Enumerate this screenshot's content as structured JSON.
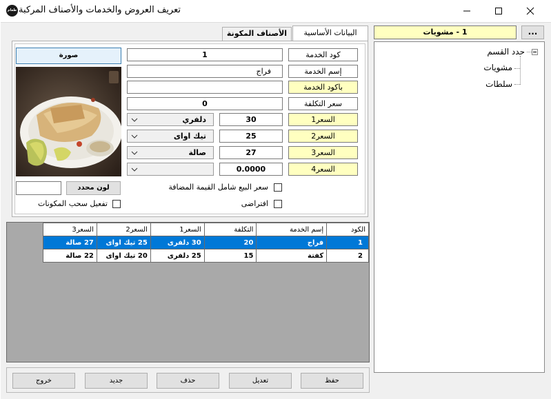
{
  "window": {
    "title": "تعريف العروض والخدمات والأصناف المركبة",
    "app_icon_text": "طعام"
  },
  "tabs": [
    {
      "label": "البيانات الأساسية"
    },
    {
      "label": "الأصناف المكونة"
    }
  ],
  "form": {
    "image_button": "صورة",
    "service_code_label": "كود الخدمة",
    "service_code_value": "1",
    "service_name_label": "إسم الخدمة",
    "service_name_value": "فراج",
    "barcode_label": "باكود الخدمة",
    "barcode_value": "",
    "cost_label": "سعر التكلفة",
    "cost_value": "0",
    "price1_label": "السعر1",
    "price1_value": "30",
    "price1_type": "دلفري",
    "price2_label": "السعر2",
    "price2_value": "25",
    "price2_type": "تيك اواى",
    "price3_label": "السعر3",
    "price3_value": "27",
    "price3_type": "صالة",
    "price4_label": "السعر4",
    "price4_value": "0.0000",
    "price4_type": "",
    "color_button": "لون محدد",
    "vat_checkbox_label": "سعر البيع شامل القيمة المضافة",
    "default_checkbox_label": "افتراضى",
    "components_checkbox_label": "تفعيل سحب المكونات"
  },
  "grid": {
    "headers": [
      "الكود",
      "إسم الخدمة",
      "التكلفة",
      "السعر1",
      "السعر2",
      "السعر3"
    ],
    "rows": [
      [
        "1",
        "فراج",
        "20",
        "30 دلفرى",
        "25 تيك اواى",
        "27 صالة"
      ],
      [
        "2",
        "كفتة",
        "15",
        "25 دلفرى",
        "20 تيك اواى",
        "22 صالة"
      ]
    ]
  },
  "buttons": {
    "save": "حفظ",
    "edit": "تعديل",
    "delete": "حذف",
    "new": "جديد",
    "exit": "خروج"
  },
  "category": {
    "selected": "1 - مشويات",
    "browse": "..."
  },
  "tree": {
    "root": "حدد القسم",
    "children": [
      "مشويات",
      "سلطات"
    ]
  }
}
